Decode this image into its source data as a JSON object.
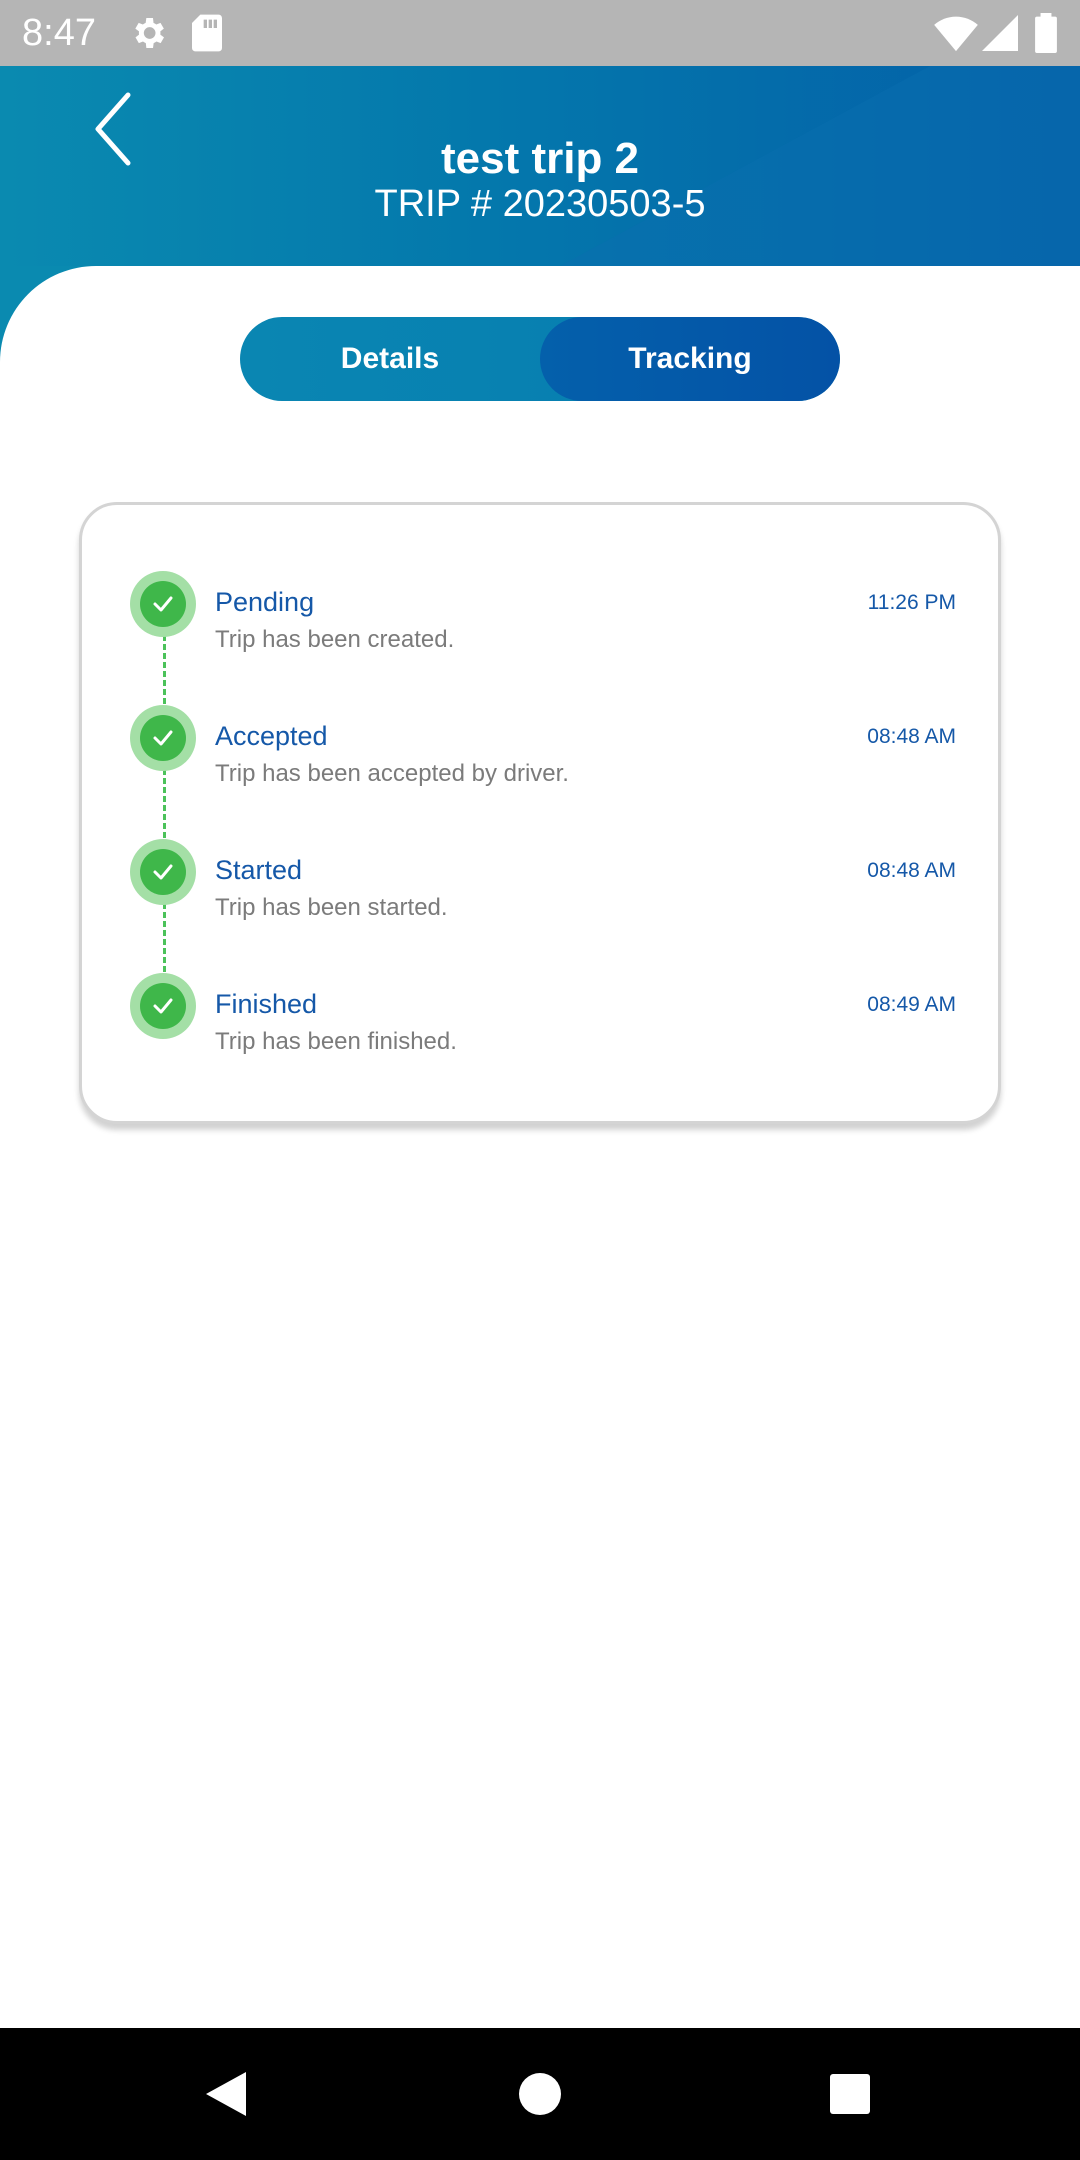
{
  "status_bar": {
    "time": "8:47",
    "icons": [
      "gear-icon",
      "sd-card-icon",
      "wifi-icon",
      "signal-icon",
      "battery-icon"
    ]
  },
  "header": {
    "title": "test trip 2",
    "subtitle": "TRIP # 20230503-5",
    "back_icon": "chevron-left-icon"
  },
  "tabs": [
    {
      "label": "Details",
      "active": false
    },
    {
      "label": "Tracking",
      "active": true
    }
  ],
  "tracking": {
    "steps": [
      {
        "status": "Pending",
        "time": "11:26 PM",
        "description": "Trip has been created.",
        "done": true
      },
      {
        "status": "Accepted",
        "time": "08:48 AM",
        "description": "Trip has been accepted by driver.",
        "done": true
      },
      {
        "status": "Started",
        "time": "08:48 AM",
        "description": "Trip has been started.",
        "done": true
      },
      {
        "status": "Finished",
        "time": "08:49 AM",
        "description": "Trip has been finished.",
        "done": true
      }
    ]
  },
  "nav_bar": {
    "icons": [
      "back-triangle-icon",
      "home-circle-icon",
      "recents-square-icon"
    ]
  },
  "colors": {
    "header_gradient_start": "#0a8ab0",
    "header_gradient_end": "#035fa8",
    "tab_active": "#0452a6",
    "accent_text": "#1558a8",
    "success_green": "#3fb74a",
    "muted_text": "#7b7b7b"
  }
}
